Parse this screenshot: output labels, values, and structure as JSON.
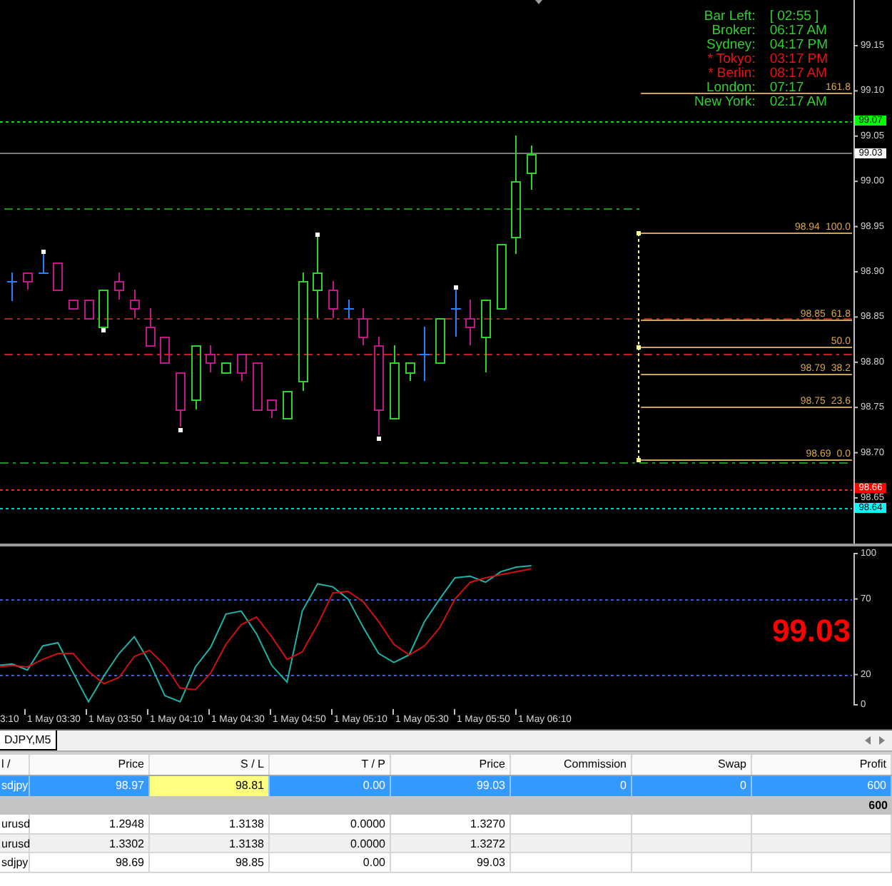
{
  "chart": {
    "clock": [
      {
        "label": "Bar Left:",
        "value": "[ 02:55 ]",
        "alert": false
      },
      {
        "label": "Broker:",
        "value": "06:17 AM",
        "alert": false
      },
      {
        "label": "Sydney:",
        "value": "04:17 PM",
        "alert": false
      },
      {
        "label": "* Tokyo:",
        "value": "03:17 PM",
        "alert": true
      },
      {
        "label": "* Berlin:",
        "value": "08:17 AM",
        "alert": true
      },
      {
        "label": "London:",
        "value": "07:17",
        "alert": false
      },
      {
        "label": "New York:",
        "value": "02:17 AM",
        "alert": false
      }
    ],
    "price_axis": [
      "99.15",
      "99.10",
      "99.05",
      "99.00",
      "98.95",
      "98.90",
      "98.85",
      "98.80",
      "98.75",
      "98.70",
      "98.65"
    ],
    "price_tags": [
      {
        "text": "99.07",
        "color": "#00ff00"
      },
      {
        "text": "99.03",
        "color": "#ffffff"
      },
      {
        "text": "98.66",
        "color": "#ff0000"
      },
      {
        "text": "98.64",
        "color": "#00ffff"
      }
    ],
    "fibonacci": [
      {
        "level": "161.8"
      },
      {
        "price": "98.94",
        "level": "100.0"
      },
      {
        "price": "98.85",
        "level": "61.8"
      },
      {
        "level": "50.0"
      },
      {
        "price": "98.79",
        "level": "38.2"
      },
      {
        "price": "98.75",
        "level": "23.6"
      },
      {
        "price": "98.69",
        "level": "0.0"
      }
    ]
  },
  "indicator": {
    "price_readout": "99.03",
    "chart_data": {
      "type": "line",
      "ylim": [
        0,
        100
      ],
      "yticks": [
        0,
        20,
        70,
        100
      ],
      "series": [
        {
          "color": "#20b2aa",
          "values": [
            26,
            27,
            23,
            39,
            41,
            21,
            2,
            19,
            34,
            45,
            28,
            6,
            2,
            25,
            38,
            60,
            62,
            47,
            26,
            15,
            62,
            80,
            78,
            70,
            51,
            34,
            28,
            33,
            55,
            70,
            84,
            85,
            81,
            88,
            91,
            92
          ]
        },
        {
          "color": "#d01010",
          "values": [
            25,
            26,
            25,
            30,
            34,
            34,
            22,
            14,
            18,
            32,
            36,
            26,
            11,
            10,
            21,
            40,
            53,
            58,
            45,
            30,
            35,
            53,
            74,
            75,
            68,
            55,
            40,
            33,
            39,
            51,
            70,
            81,
            84,
            86,
            88,
            90
          ]
        }
      ]
    }
  },
  "time_axis": [
    "3:10",
    "1 May 03:30",
    "1 May 03:50",
    "1 May 04:10",
    "1 May 04:30",
    "1 May 04:50",
    "1 May 05:10",
    "1 May 05:30",
    "1 May 05:50",
    "1 May 06:10"
  ],
  "terminal": {
    "tabs": [
      {
        "label": "DJPY,M5",
        "selected": true
      }
    ],
    "columns": [
      "l /",
      "Price",
      "S / L",
      "T / P",
      "Price",
      "Commission",
      "Swap",
      "Profit"
    ],
    "rows": [
      {
        "kind": "position",
        "selected": true,
        "sl_highlighted": true,
        "cells": [
          "sdjpy",
          "98.97",
          "98.81",
          "0.00",
          "99.03",
          "0",
          "0",
          "600"
        ]
      },
      {
        "kind": "total",
        "selected": false,
        "value": "600"
      },
      {
        "kind": "order",
        "selected": false,
        "sl_highlighted": false,
        "cells": [
          "urusd",
          "1.2948",
          "1.3138",
          "0.0000",
          "1.3270"
        ]
      },
      {
        "kind": "order",
        "selected": false,
        "sl_highlighted": false,
        "cells": [
          "urusd",
          "1.3302",
          "1.3138",
          "0.0000",
          "1.3272"
        ]
      },
      {
        "kind": "order",
        "selected": false,
        "sl_highlighted": false,
        "cells": [
          "sdjpy",
          "98.69",
          "98.85",
          "0.00",
          "99.03"
        ]
      }
    ]
  }
}
